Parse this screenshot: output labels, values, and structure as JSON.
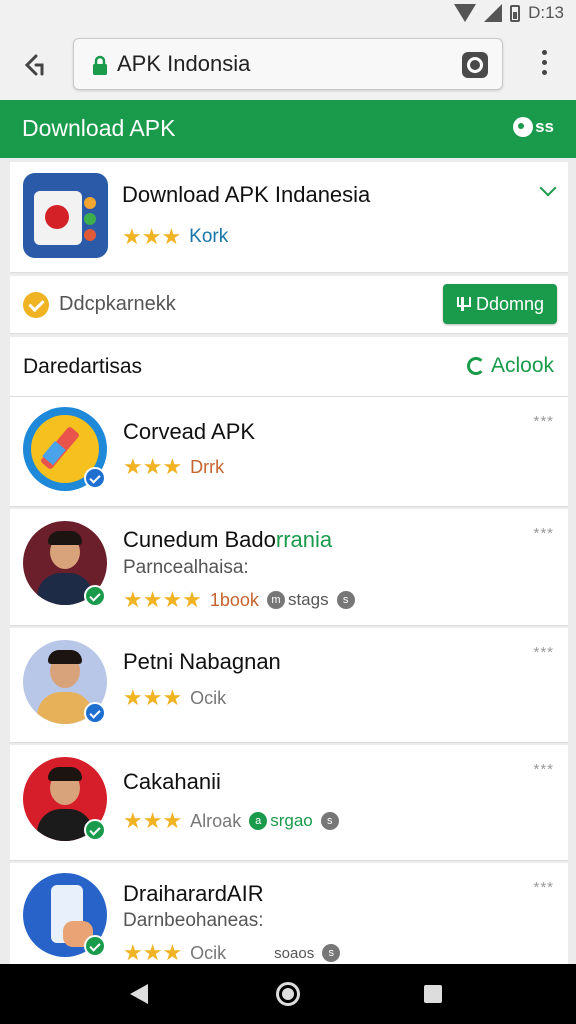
{
  "status_bar": {
    "time": "D:13"
  },
  "browser": {
    "url": "APK Indonsia"
  },
  "app_bar": {
    "title": "Download APK",
    "action_label": "ss"
  },
  "featured": {
    "title": "Download APK Indanesia",
    "rating_text": "Kork",
    "stars": "★★★"
  },
  "status_row": {
    "text": "Ddcpkarnekk",
    "button_label": "Ddomng"
  },
  "section": {
    "title": "Daredartisas",
    "link_label": "Aclook"
  },
  "apps": [
    {
      "title": "Corvead APK",
      "subtitle": "",
      "stars": "★★★",
      "rating_text": "Drrk",
      "rating_color": "#c5642f",
      "meta": "***",
      "badge_color": "#1e6fd0"
    },
    {
      "title": "Cunedum Bado",
      "title_accent": "rrania",
      "subtitle": "Parncealhaisa:",
      "stars": "★★★★",
      "rating_text": "1book",
      "rating_color": "#c5642f",
      "chip1_icon": "m",
      "chip1_label": "stags",
      "chip2_icon": "s",
      "meta": "***",
      "badge_color": "#1a9b4b"
    },
    {
      "title": "Petni Nabagnan",
      "subtitle": "",
      "stars": "★★★",
      "rating_text": "Ocik",
      "rating_color": "#777777",
      "meta": "***",
      "badge_color": "#1e6fd0"
    },
    {
      "title": "Cakahanii",
      "subtitle": "",
      "stars": "★★★",
      "rating_text": "Alroak",
      "rating_color": "#777777",
      "chip1_icon": "a",
      "chip1_label": "srgao",
      "chip2_icon": "s",
      "meta": "***",
      "badge_color": "#1a9b4b"
    },
    {
      "title": "DraiharardAIR",
      "subtitle": "Darnbeohaneas:",
      "stars": "★★★",
      "rating_text": "Ocik",
      "rating_color": "#777777",
      "chip1_label": "soaos",
      "chip2_icon": "s",
      "meta": "***",
      "badge_color": "#1a9b4b"
    }
  ],
  "colors": {
    "brand_green": "#1a9b4b",
    "star": "#f0b323",
    "link_blue": "#1976a8"
  }
}
